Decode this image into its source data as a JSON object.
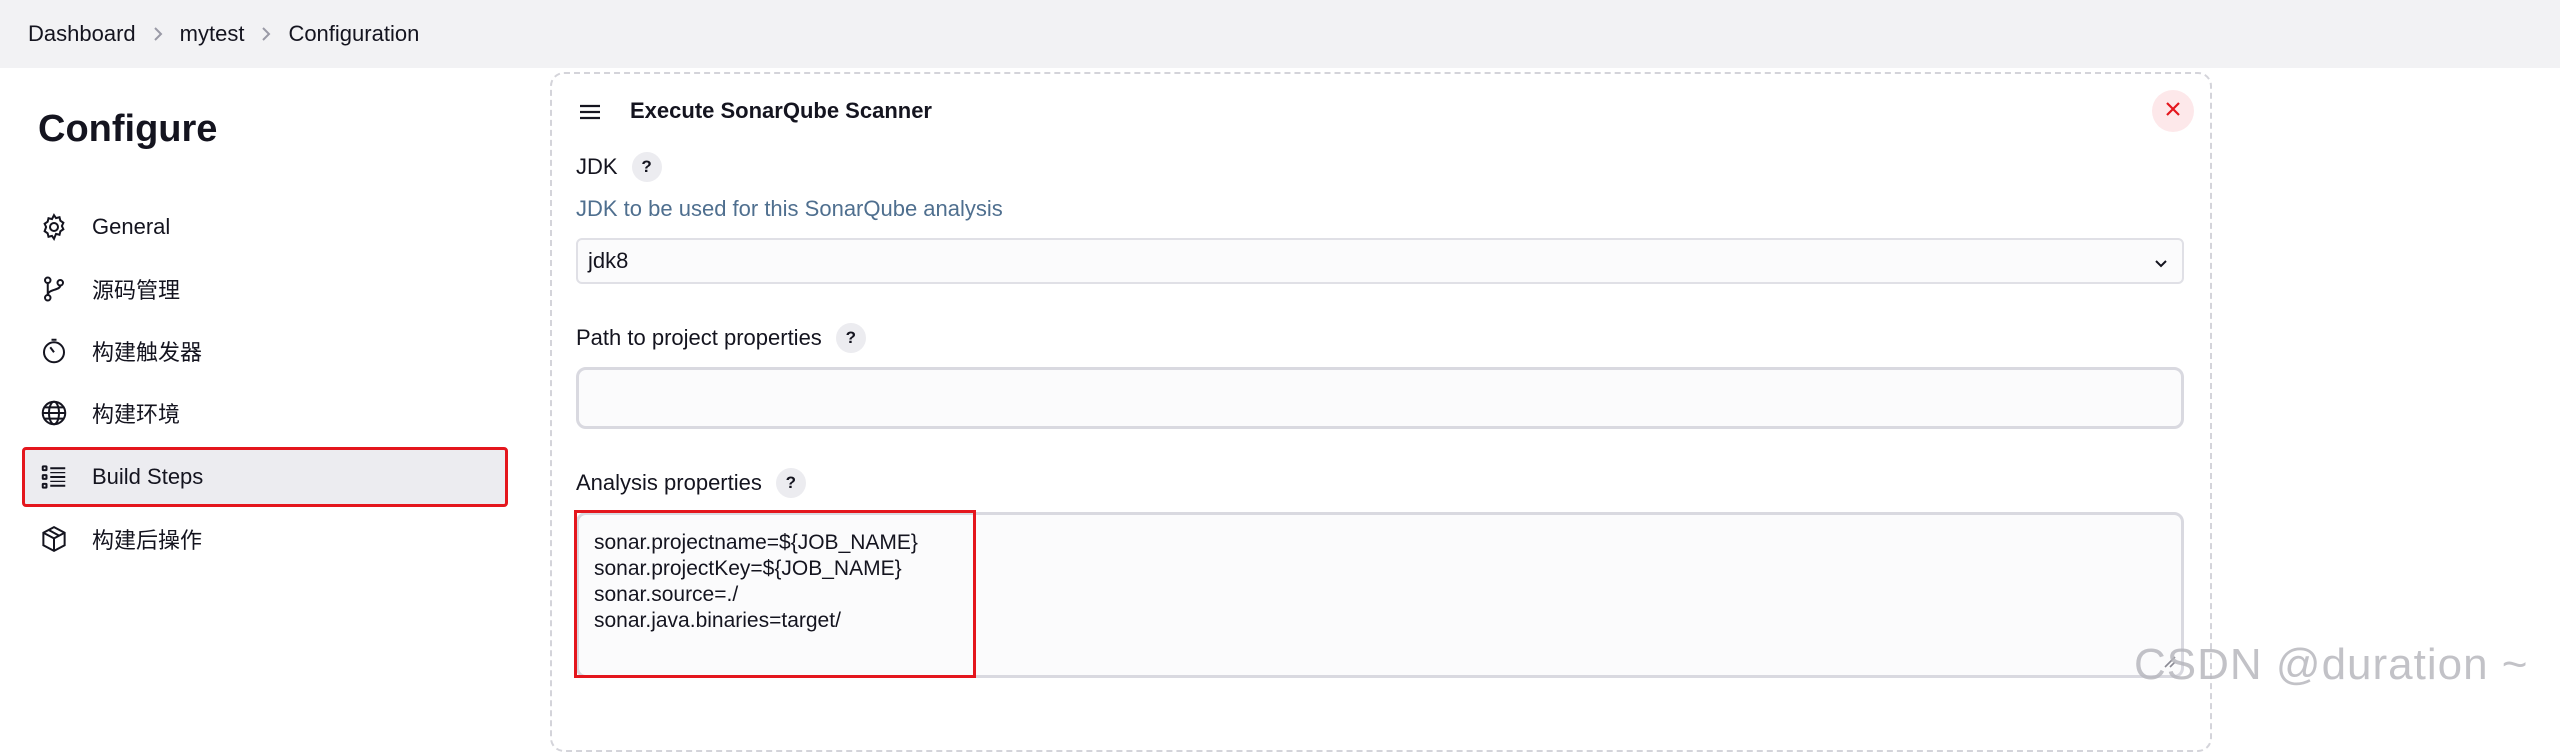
{
  "breadcrumb": {
    "items": [
      "Dashboard",
      "mytest",
      "Configuration"
    ]
  },
  "sidebar": {
    "title": "Configure",
    "items": [
      {
        "label": "General",
        "icon": "gear-icon"
      },
      {
        "label": "源码管理",
        "icon": "branch-icon"
      },
      {
        "label": "构建触发器",
        "icon": "timer-icon"
      },
      {
        "label": "构建环境",
        "icon": "globe-icon"
      },
      {
        "label": "Build Steps",
        "icon": "list-icon",
        "active": true
      },
      {
        "label": "构建后操作",
        "icon": "package-icon"
      }
    ]
  },
  "step": {
    "title": "Execute SonarQube Scanner",
    "jdk_label": "JDK",
    "jdk_description": "JDK to be used for this SonarQube analysis",
    "jdk_selected": "jdk8",
    "path_label": "Path to project properties",
    "path_value": "",
    "analysis_label": "Analysis properties",
    "analysis_lines": [
      "sonar.projectname=${JOB_NAME}",
      "sonar.projectKey=${JOB_NAME}",
      "sonar.source=./",
      "sonar.java.binaries=target/"
    ],
    "help_glyph": "?"
  },
  "watermark": "CSDN @duration ~",
  "colors": {
    "accent_red": "#e4161d",
    "description_blue": "#4f6f8f"
  }
}
